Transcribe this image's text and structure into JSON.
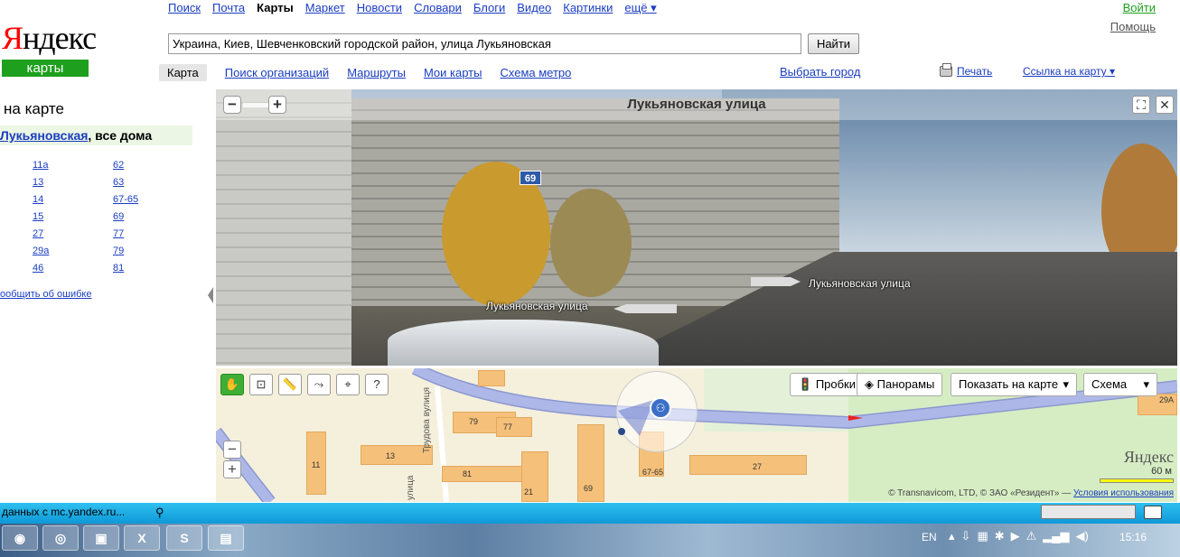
{
  "brand": {
    "logo": "Яндекс",
    "service": "карты"
  },
  "topnav": {
    "items": [
      "Поиск",
      "Почта",
      "Карты",
      "Маркет",
      "Новости",
      "Словари",
      "Блоги",
      "Видео",
      "Картинки",
      "ещё ▾"
    ],
    "current": "Карты"
  },
  "header": {
    "login": "Войти",
    "help": "Помощь"
  },
  "search": {
    "value": "Украина, Киев, Шевченковский городской район, улица Лукьяновская",
    "button": "Найти"
  },
  "subnav": {
    "current": "Карта",
    "items": [
      "Поиск организаций",
      "Маршруты",
      "Мои карты",
      "Схема метро"
    ],
    "city": "Выбрать город",
    "print": "Печать",
    "link": "Ссылка на карту ▾"
  },
  "left": {
    "title": "на карте",
    "street_link": "Лукьяновская",
    "street_suffix": ", все дома",
    "houses": [
      "11а",
      "62",
      "13",
      "63",
      "14",
      "67-65",
      "15",
      "69",
      "27",
      "77",
      "29а",
      "79",
      "46",
      "81"
    ],
    "report": "ообщить об ошибке"
  },
  "panorama": {
    "title": "Лукьяновская улица",
    "labels": [
      "Лукьяновская улица",
      "Лукьяновская улица"
    ],
    "badge": "69"
  },
  "map": {
    "buttons": {
      "traffic": "Пробки",
      "panoramas": "Панорамы",
      "show": "Показать на карте",
      "scheme": "Схема"
    },
    "labels": [
      "79",
      "77",
      "13",
      "11",
      "81",
      "21",
      "69",
      "67-65",
      "27",
      "29А"
    ],
    "streets": [
      "Трудова вулиця",
      "улица"
    ],
    "copyright_text": "© Transnavicom, LTD, © ЗАО «Резидент» — ",
    "copyright_link": "Условия использования",
    "logo": "Яндекс",
    "scale": "60 м"
  },
  "statusbar": {
    "text": "данных с mc.yandex.ru..."
  },
  "taskbar": {
    "lang": "EN",
    "time": "15:16"
  },
  "colors": {
    "brand_green": "#1ea01e",
    "link": "#1a3dc1",
    "road": "#aeb8e8",
    "block": "#f5c07a"
  }
}
